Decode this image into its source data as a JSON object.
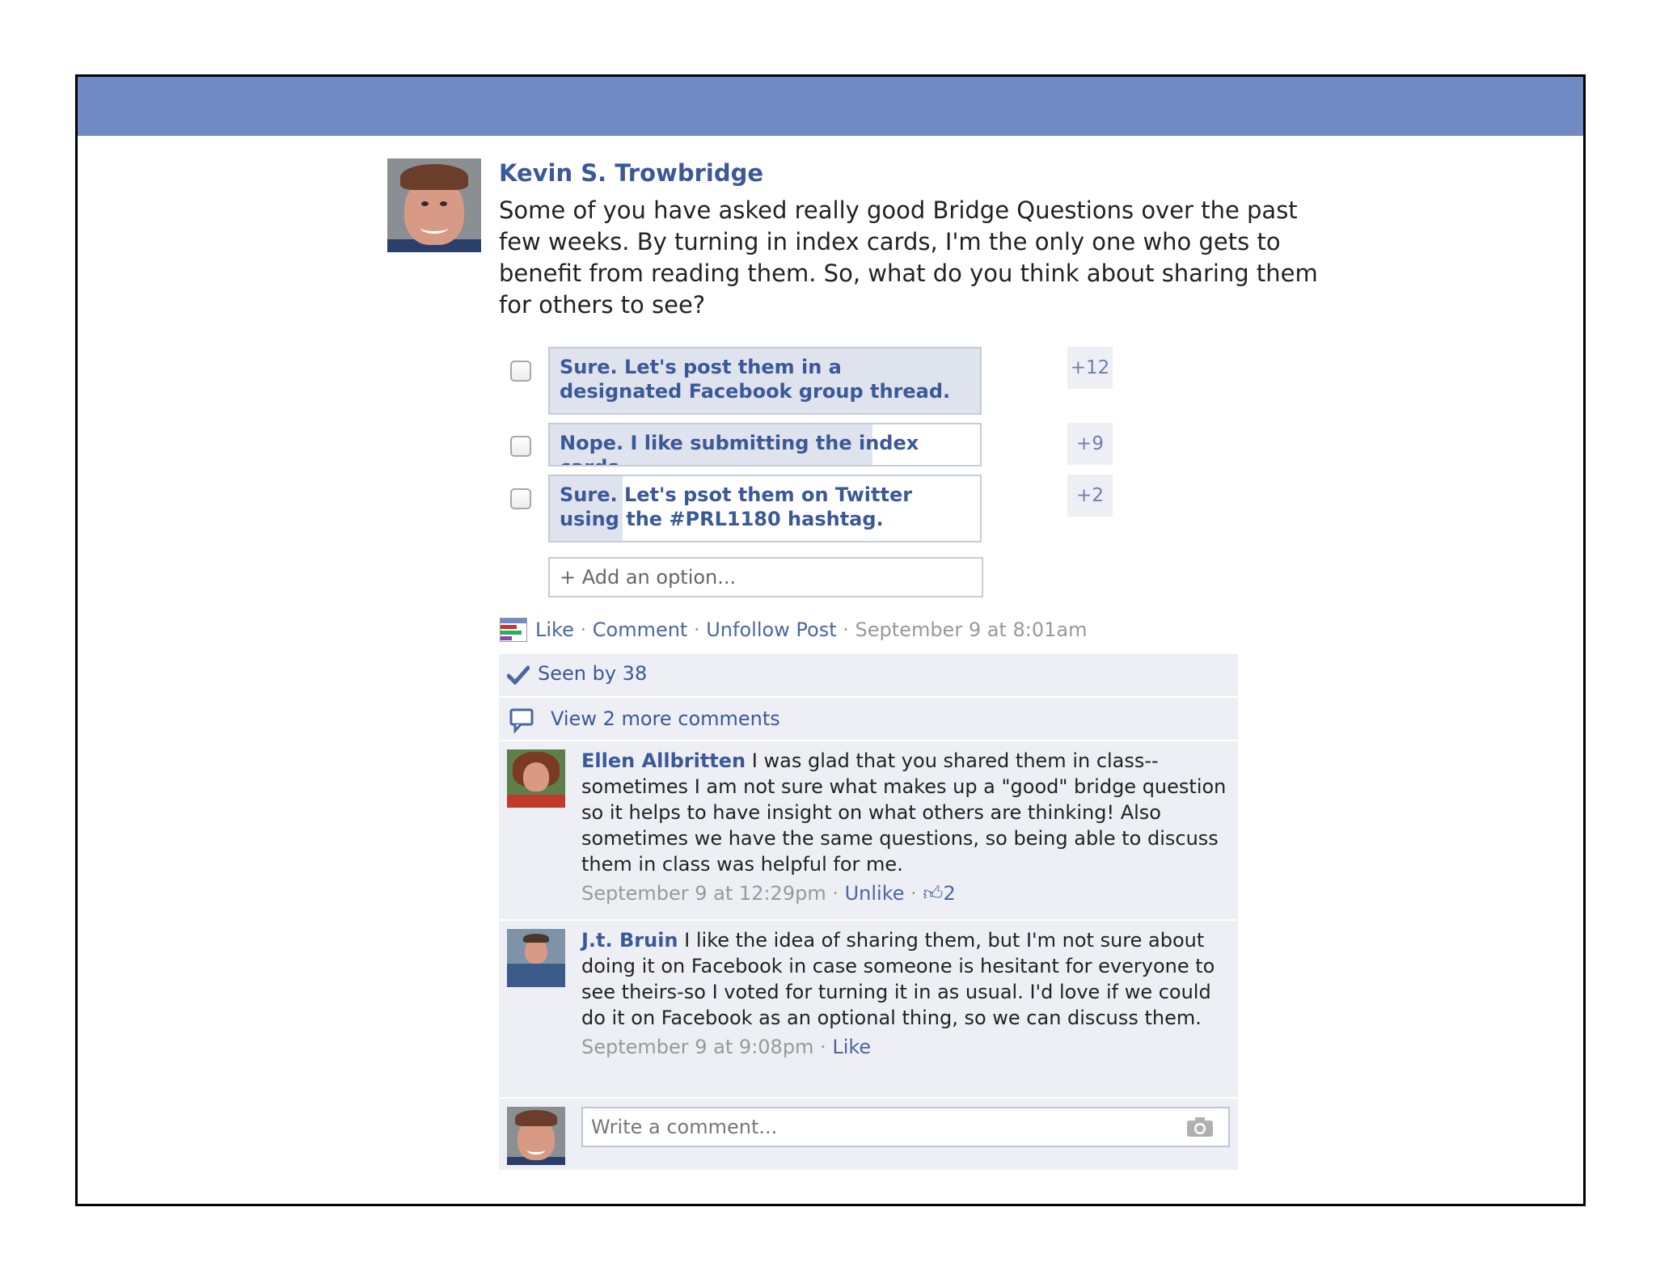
{
  "post": {
    "author": "Kevin S. Trowbridge",
    "text": "Some of you have asked really good Bridge Questions over the past few weeks. By turning in index cards, I'm the only one who gets to benefit from reading them. So, what do you think about sharing them for others to see?"
  },
  "poll": {
    "options": [
      {
        "label": "Sure. Let's post them in a designated Facebook group thread.",
        "count": "+12",
        "fill": 1.0
      },
      {
        "label": "Nope. I like submitting the index cards.",
        "count": "+9",
        "fill": 0.75
      },
      {
        "label": "Sure. Let's psot them on Twitter using the #PRL1180 hashtag.",
        "count": "+2",
        "fill": 0.17
      }
    ],
    "add_option_placeholder": "+ Add an option..."
  },
  "actions": {
    "like": "Like",
    "sep": " · ",
    "comment": "Comment",
    "unfollow": "Unfollow Post",
    "timestamp": "September 9 at 8:01am"
  },
  "seen": "Seen by 38",
  "view_more": "View 2 more comments",
  "comments": [
    {
      "name": "Ellen Allbritten",
      "text": " I was glad that you shared them in class-- sometimes I am not sure what makes up a \"good\" bridge question so it helps to have insight on what others are thinking! Also sometimes we have the same questions, so being able to discuss them in class was helpful for me.",
      "time": "September 9 at 12:29pm",
      "action": "Unlike",
      "likes": "2"
    },
    {
      "name": "J.t. Bruin",
      "text": " I like the idea of sharing them, but I'm not sure about doing it on Facebook in case someone is hesitant for everyone to see theirs-so I voted for turning it in as usual. I'd love if we could do it on Facebook as an optional thing, so we can discuss them.",
      "time": "September 9 at 9:08pm",
      "action": "Like"
    }
  ],
  "compose": {
    "placeholder": "Write a comment..."
  },
  "colors": {
    "header": "#6f8ac4",
    "link": "#3b5998",
    "feed_bg": "#edeff4"
  }
}
